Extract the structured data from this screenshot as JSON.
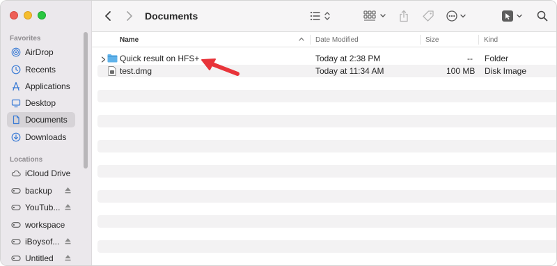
{
  "window": {
    "title": "Documents",
    "colors": {
      "sidebar_bg": "#ebe8ec",
      "accent_folder": "#4ba3e0",
      "annotation_arrow": "#e8343a"
    }
  },
  "sidebar": {
    "favorites_title": "Favorites",
    "favorites": [
      {
        "label": "AirDrop",
        "icon": "airdrop-icon"
      },
      {
        "label": "Recents",
        "icon": "clock-icon"
      },
      {
        "label": "Applications",
        "icon": "applications-icon"
      },
      {
        "label": "Desktop",
        "icon": "desktop-icon"
      },
      {
        "label": "Documents",
        "icon": "document-icon",
        "selected": true
      },
      {
        "label": "Downloads",
        "icon": "download-icon"
      }
    ],
    "locations_title": "Locations",
    "locations": [
      {
        "label": "iCloud Drive",
        "icon": "cloud-icon"
      },
      {
        "label": "backup",
        "icon": "drive-icon",
        "eject": true
      },
      {
        "label": "YouTub...",
        "icon": "drive-icon",
        "eject": true
      },
      {
        "label": "workspace",
        "icon": "drive-icon"
      },
      {
        "label": "iBoysof...",
        "icon": "drive-icon",
        "eject": true
      },
      {
        "label": "Untitled",
        "icon": "drive-icon",
        "eject": true
      }
    ]
  },
  "toolbar": {
    "icons": [
      "back-icon",
      "forward-icon",
      "list-view-icon",
      "grid-view-icon",
      "share-icon",
      "tag-icon",
      "more-icon",
      "preview-icon",
      "search-icon"
    ]
  },
  "columns": {
    "name": "Name",
    "date": "Date Modified",
    "size": "Size",
    "kind": "Kind"
  },
  "files": [
    {
      "name": "Quick result on HFS+",
      "date": "Today at 2:38 PM",
      "size": "--",
      "kind": "Folder",
      "icon": "folder-icon"
    },
    {
      "name": "test.dmg",
      "date": "Today at 11:34 AM",
      "size": "100 MB",
      "kind": "Disk Image",
      "icon": "disk-image-icon"
    }
  ]
}
